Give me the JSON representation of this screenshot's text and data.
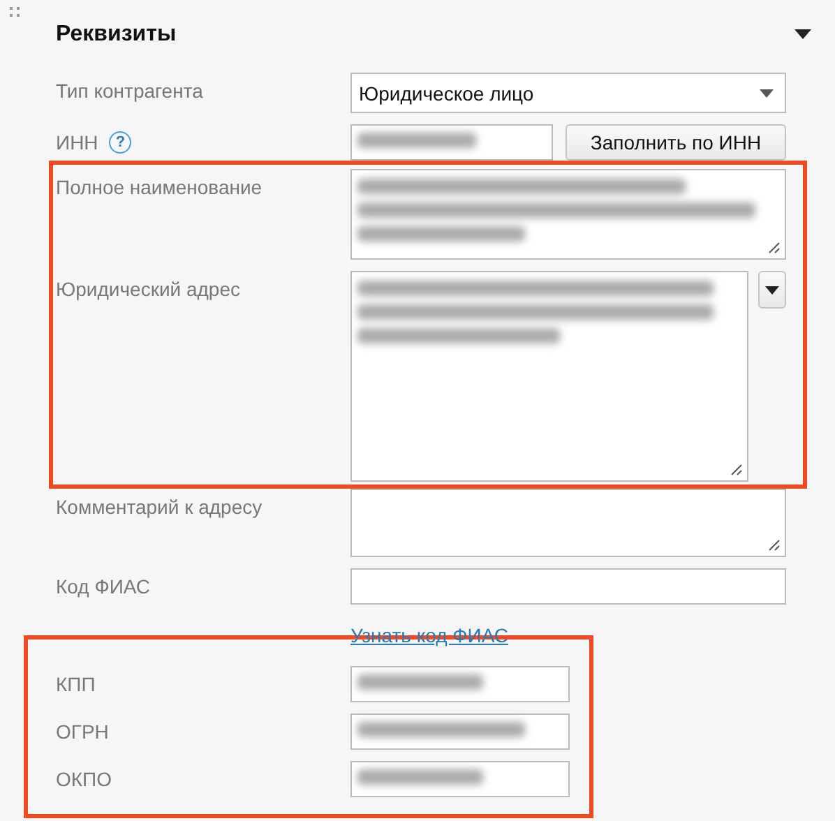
{
  "section": {
    "title": "Реквизиты",
    "expanded": true
  },
  "groups": [
    {
      "highlighted": false,
      "rows": [
        {
          "kind": "select",
          "label": "Тип контрагента",
          "value": "Юридическое лицо"
        },
        {
          "kind": "input_button",
          "label": "ИНН",
          "help": "?",
          "redacted": true,
          "button": "Заполнить по ИНН"
        }
      ]
    },
    {
      "highlighted": true,
      "rows": [
        {
          "kind": "textarea",
          "label": "Полное наименование",
          "redacted": true
        },
        {
          "kind": "textarea_dropdown",
          "label": "Юридический адрес",
          "redacted": true
        }
      ]
    },
    {
      "highlighted": false,
      "rows": [
        {
          "kind": "textarea_small",
          "label": "Комментарий к адресу",
          "redacted": false
        },
        {
          "kind": "input",
          "label": "Код ФИАС",
          "redacted": false
        },
        {
          "kind": "link",
          "text": "Узнать код ФИАС"
        }
      ]
    },
    {
      "highlighted": true,
      "rows": [
        {
          "kind": "short_input",
          "label": "КПП",
          "redacted": true
        },
        {
          "kind": "short_input",
          "label": "ОГРН",
          "redacted": true
        },
        {
          "kind": "short_input",
          "label": "ОКПО",
          "redacted": true
        }
      ]
    }
  ]
}
